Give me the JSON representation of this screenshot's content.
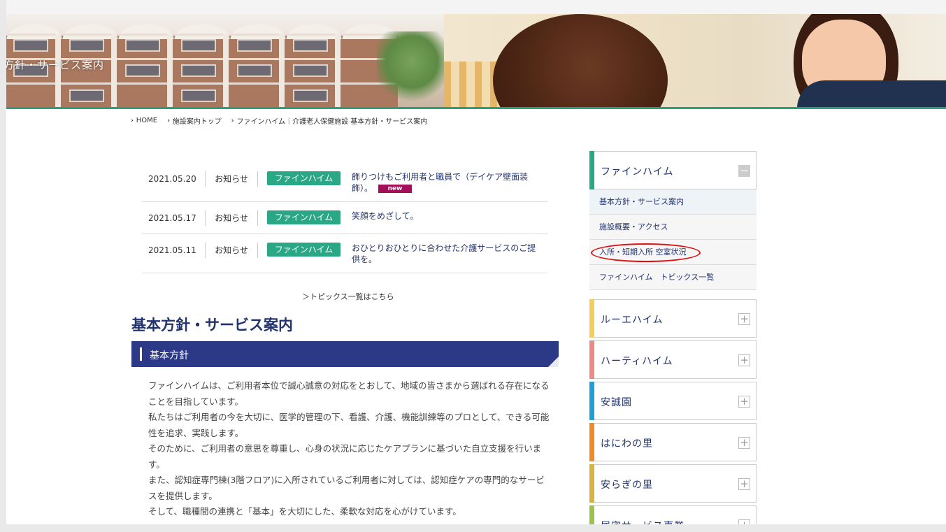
{
  "hero": {
    "title": "方針・サービス案内"
  },
  "breadcrumb": [
    {
      "label": "HOME"
    },
    {
      "label": "施設案内トップ"
    },
    {
      "label": "ファインハイム｜介護老人保健施設 基本方針・サービス案内"
    }
  ],
  "news": {
    "items": [
      {
        "date": "2021.05.20",
        "category": "お知らせ",
        "tag": "ファインハイム",
        "title": "飾りつけもご利用者と職員で（デイケア壁面装飾）。",
        "badge": "new"
      },
      {
        "date": "2021.05.17",
        "category": "お知らせ",
        "tag": "ファインハイム",
        "title": "笑顔をめざして。",
        "badge": ""
      },
      {
        "date": "2021.05.11",
        "category": "お知らせ",
        "tag": "ファインハイム",
        "title": "おひとりおひとりに合わせた介護サービスのご提供を。",
        "badge": ""
      }
    ],
    "more_link": "＞トピックス一覧はこちら"
  },
  "main": {
    "heading": "基本方針・サービス案内",
    "section_title": "基本方針",
    "paragraphs": [
      "ファインハイムは、ご利用者本位で誠心誠意の対応をとおして、地域の皆さまから選ばれる存在になることを目指しています。",
      "私たちはご利用者の今を大切に、医学的管理の下、看護、介護、機能訓練等のプロとして、できる可能性を追求、実践します。",
      "そのために、ご利用者の意思を尊重し、心身の状況に応じたケアプランに基づいた自立支援を行います。",
      "また、認知症専門棟(3階フロア)に入所されているご利用者に対しては、認知症ケアの専門的なサービスを提供します。",
      "そして、職種間の連携と「基本」を大切にした、柔軟な対応を心がけています。"
    ]
  },
  "sidebar": {
    "open_group": {
      "title": "ファインハイム",
      "toggle": "−",
      "color": "#2aa886",
      "items": [
        {
          "label": "基本方針・サービス案内"
        },
        {
          "label": "施設概要・アクセス"
        },
        {
          "label": "入所・短期入所 空室状況"
        },
        {
          "label": "ファインハイム　トピックス一覧"
        }
      ]
    },
    "groups": [
      {
        "title": "ルーエハイム",
        "toggle": "+",
        "color": "#f2cf5b"
      },
      {
        "title": "ハーティハイム",
        "toggle": "+",
        "color": "#ec8a88"
      },
      {
        "title": "安誠園",
        "toggle": "+",
        "color": "#1f9fd2"
      },
      {
        "title": "はにわの里",
        "toggle": "+",
        "color": "#ee8a2a"
      },
      {
        "title": "安らぎの里",
        "toggle": "+",
        "color": "#d6b23f"
      },
      {
        "title": "居宅サービス事業",
        "toggle": "+",
        "color": "#9bc24a"
      }
    ]
  }
}
